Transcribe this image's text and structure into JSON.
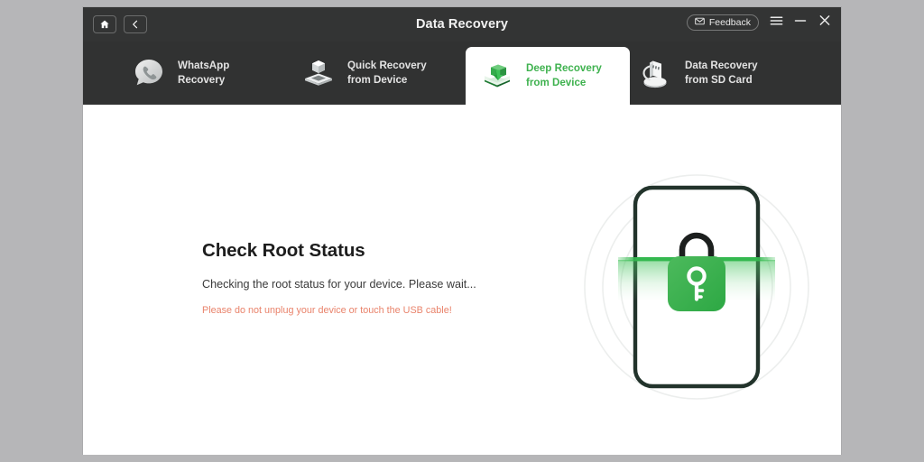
{
  "window": {
    "title": "Data Recovery",
    "nav": {
      "home_icon": "home-icon",
      "back_icon": "chevron-left-icon"
    },
    "controls": {
      "feedback_label": "Feedback",
      "feedback_icon": "envelope-icon",
      "menu_icon": "hamburger-menu-icon",
      "minimize_icon": "minimize-icon",
      "close_icon": "close-icon"
    }
  },
  "tabs": [
    {
      "id": "whatsapp-recovery",
      "label": "WhatsApp\nRecovery",
      "icon": "whatsapp-phone-bubble-icon",
      "active": false
    },
    {
      "id": "quick-recovery-from-device",
      "label": "Quick Recovery\nfrom Device",
      "icon": "cube-on-platform-icon",
      "active": false
    },
    {
      "id": "deep-recovery-from-device",
      "label": "Deep Recovery\nfrom Device",
      "icon": "green-box-download-icon",
      "active": true
    },
    {
      "id": "data-recovery-from-sd-card",
      "label": "Data Recovery\nfrom SD Card",
      "icon": "sd-card-reader-icon",
      "active": false
    }
  ],
  "main": {
    "heading": "Check Root Status",
    "description": "Checking the root status for your device. Please wait...",
    "warning": "Please do not unplug your device or touch the USB cable!",
    "illustration": {
      "name": "phone-lock-scan-illustration",
      "phone_icon": "smartphone-outline-icon",
      "lock_icon": "padlock-key-icon",
      "scanline_icon": "scan-line-icon"
    }
  },
  "colors": {
    "accent_green": "#3fb24f",
    "lock_green": "#3cb054",
    "warning": "#e9836b",
    "titlebar": "#333434",
    "tabbar": "#313232",
    "page_background": "#b6b6b8",
    "phone_outline": "#22332b"
  }
}
